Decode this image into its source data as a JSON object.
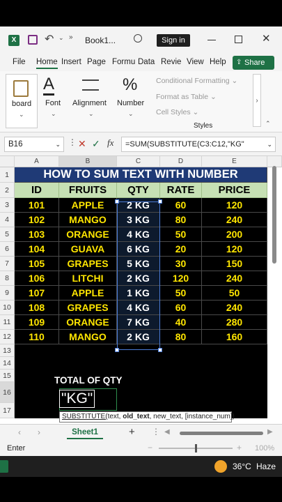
{
  "app": {
    "filename": "Book1...",
    "sign_in": "Sign in",
    "share": "Share"
  },
  "menu": [
    "File",
    "Home",
    "Insert",
    "Page",
    "Formu",
    "Data",
    "Revie",
    "View",
    "Help"
  ],
  "ribbon": {
    "clipboard": "board",
    "font": "Font",
    "alignment": "Alignment",
    "number": "Number",
    "conditional_formatting": "Conditional Formatting",
    "format_as_table": "Format as Table",
    "cell_styles": "Cell Styles",
    "styles_group": "Styles"
  },
  "formula_bar": {
    "name_box": "B16",
    "formula": "=SUM(SUBSTITUTE(C3:C12,\"KG\""
  },
  "columns": [
    "A",
    "B",
    "C",
    "D",
    "E"
  ],
  "rows": [
    "1",
    "2",
    "3",
    "4",
    "5",
    "6",
    "7",
    "8",
    "9",
    "10",
    "11",
    "12",
    "13",
    "14",
    "15",
    "16",
    "17"
  ],
  "sheet": {
    "title": "HOW TO SUM TEXT WITH NUMBER",
    "headers": [
      "ID",
      "FRUITS",
      "QTY",
      "RATE",
      "PRICE"
    ],
    "data": [
      [
        "101",
        "APPLE",
        "2 KG",
        "60",
        "120"
      ],
      [
        "102",
        "MANGO",
        "3 KG",
        "80",
        "240"
      ],
      [
        "103",
        "ORANGE",
        "4 KG",
        "50",
        "200"
      ],
      [
        "104",
        "GUAVA",
        "6 KG",
        "20",
        "120"
      ],
      [
        "105",
        "GRAPES",
        "5 KG",
        "30",
        "150"
      ],
      [
        "106",
        "LITCHI",
        "2 KG",
        "120",
        "240"
      ],
      [
        "107",
        "APPLE",
        "1 KG",
        "50",
        "50"
      ],
      [
        "108",
        "GRAPES",
        "4 KG",
        "60",
        "240"
      ],
      [
        "109",
        "ORANGE",
        "7 KG",
        "40",
        "280"
      ],
      [
        "110",
        "MANGO",
        "2 KG",
        "80",
        "160"
      ]
    ],
    "total_label": "TOTAL OF QTY",
    "edit_text": "\"KG\"",
    "tooltip": {
      "fn": "SUBSTITUTE(",
      "arg1": "text, ",
      "arg2": "old_text",
      "rest": ", new_text, [instance_num])"
    }
  },
  "tabs": {
    "sheet1": "Sheet1",
    "add": "+"
  },
  "status": {
    "mode": "Enter",
    "zoom": "100%"
  },
  "taskbar": {
    "temperature": "36°C",
    "weather": "Haze"
  },
  "colors": {
    "excel_green": "#1e7145",
    "title_blue": "#1f3a76",
    "header_green": "#c6e0b4",
    "data_yellow": "#ffe600"
  }
}
